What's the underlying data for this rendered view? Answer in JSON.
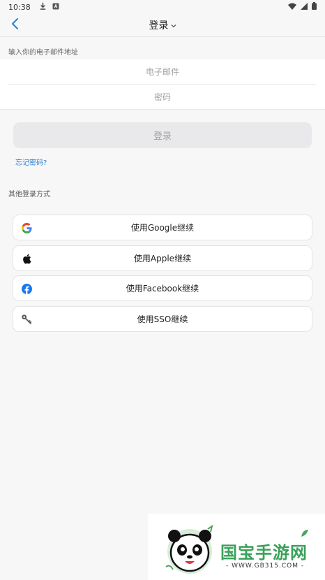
{
  "status_bar": {
    "time": "10:38",
    "left_icons": [
      "download-icon",
      "font-app-icon"
    ],
    "right_icons": [
      "wifi-icon",
      "signal-icon",
      "battery-icon"
    ]
  },
  "header": {
    "title": "登录",
    "dropdown_icon": "chevron-down-icon",
    "back_icon": "back-arrow-icon"
  },
  "form": {
    "email_caption": "输入你的电子邮件地址",
    "email": {
      "value": "",
      "placeholder": "电子邮件"
    },
    "password": {
      "value": "",
      "placeholder": "密码"
    },
    "login_button": "登录",
    "forgot_password": "忘记密码?"
  },
  "other_methods": {
    "caption": "其他登录方式",
    "buttons": [
      {
        "label": "使用Google继续",
        "icon": "google-icon"
      },
      {
        "label": "使用Apple继续",
        "icon": "apple-icon"
      },
      {
        "label": "使用Facebook继续",
        "icon": "facebook-icon"
      },
      {
        "label": "使用SSO继续",
        "icon": "key-icon"
      }
    ]
  },
  "watermark": {
    "brand": "国宝手游网",
    "url": "- WWW.GB315.COM -"
  },
  "colors": {
    "accent": "#2c7fd1",
    "background": "#f7f7f8",
    "button_disabled": "#e9e9ec",
    "facebook": "#1877f2",
    "watermark_green": "#3aa15a"
  }
}
